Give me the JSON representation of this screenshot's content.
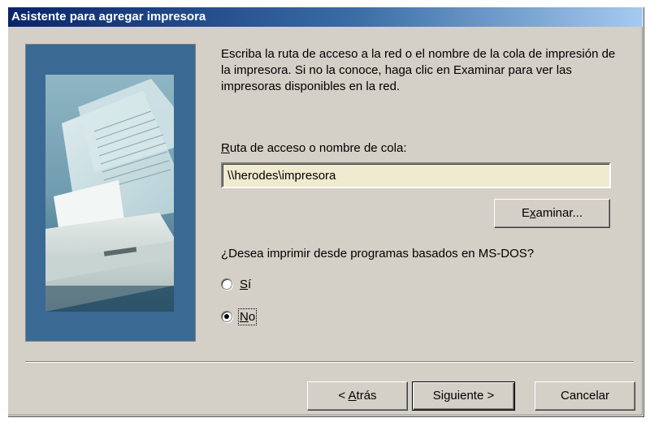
{
  "window": {
    "title": "Asistente para agregar impresora"
  },
  "wizard": {
    "instructions": "Escriba la ruta de acceso a la red o el nombre de la cola de impresión de la impresora. Si no la conoce, haga clic en Examinar para ver las impresoras disponibles en la red.",
    "path_label": {
      "mnemonic": "R",
      "rest": "uta de acceso o nombre de cola:"
    },
    "path_value": "\\\\herodes\\impresora",
    "browse_label": {
      "before": "E",
      "mnemonic": "x",
      "after": "aminar..."
    },
    "question": "¿Desea imprimir desde programas basados en MS-DOS?",
    "options": [
      {
        "mnemonic": "S",
        "rest": "í",
        "selected": false
      },
      {
        "mnemonic": "N",
        "rest": "o",
        "selected": true
      }
    ]
  },
  "buttons": {
    "back": {
      "prefix": "< ",
      "mnemonic": "A",
      "rest": "trás"
    },
    "next": "Siguiente >",
    "cancel": "Cancelar"
  },
  "colors": {
    "title_start": "#0a246a",
    "title_end": "#a6caf0",
    "panel": "#3a6a93",
    "face": "#d4d0c8",
    "input_bg": "#f0ead0"
  },
  "icons": {
    "side_image": "printer-photo-illustration"
  }
}
